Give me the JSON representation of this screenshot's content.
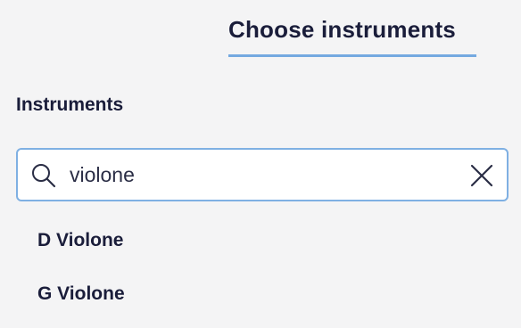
{
  "tabs": {
    "active_label": "Choose instruments"
  },
  "section": {
    "title": "Instruments"
  },
  "search": {
    "value": "violone",
    "icon": "search-icon",
    "clear_icon": "close-icon"
  },
  "results": [
    {
      "label": "D Violone"
    },
    {
      "label": "G Violone"
    }
  ],
  "colors": {
    "background": "#f4f4f5",
    "accent": "#74a9e0",
    "text": "#1a1d3a"
  }
}
